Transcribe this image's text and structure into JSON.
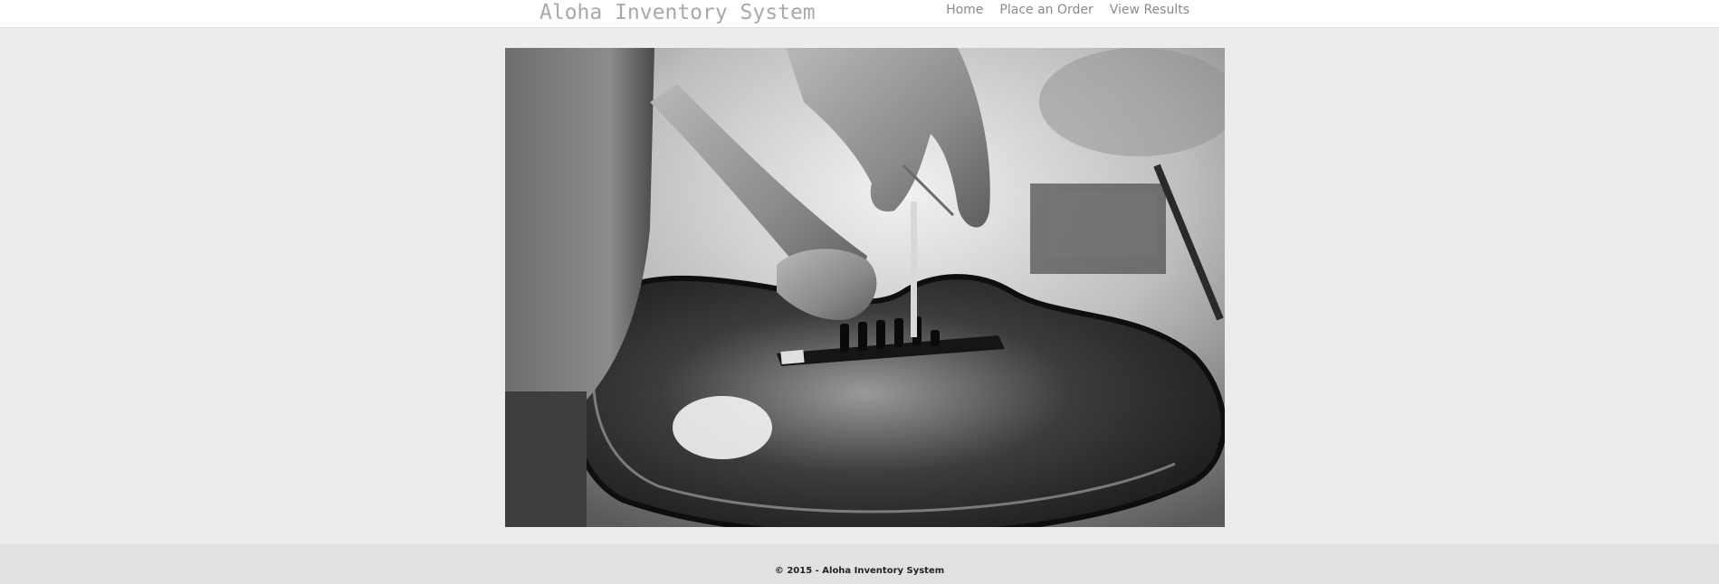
{
  "header": {
    "brand": "Aloha Inventory System",
    "nav": [
      {
        "label": "Home"
      },
      {
        "label": "Place an Order"
      },
      {
        "label": "View Results"
      }
    ]
  },
  "footer": {
    "copyright": "© 2015 - Aloha Inventory System"
  },
  "colors": {
    "page_background": "#ececec",
    "header_background": "#ffffff",
    "footer_background": "#e1e1e1",
    "brand_text": "#a9a9a9",
    "nav_text": "#8a8a8a"
  }
}
